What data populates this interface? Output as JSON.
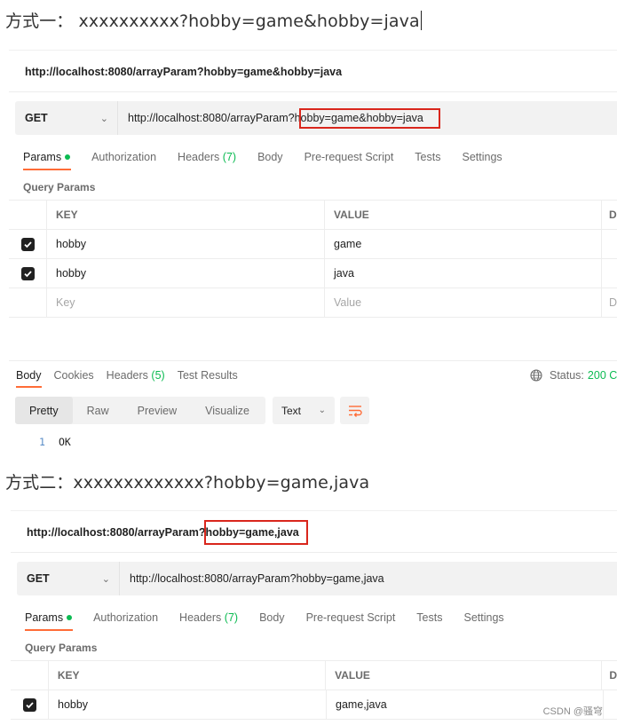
{
  "heading1": "方式一： xxxxxxxxxx?hobby=game&hobby=java",
  "heading2": "方式二：xxxxxxxxxxxxx?hobby=game,java",
  "panel1": {
    "request_name": "http://localhost:8080/arrayParam?hobby=game&hobby=java",
    "method": "GET",
    "url_base": "http://localhost:8080/arrayParam?",
    "url_query": "hobby=game&hobby=java",
    "tabs": [
      {
        "label": "Params",
        "active": true
      },
      {
        "label": "Authorization"
      },
      {
        "label": "Headers",
        "count": "(7)"
      },
      {
        "label": "Body"
      },
      {
        "label": "Pre-request Script"
      },
      {
        "label": "Tests"
      },
      {
        "label": "Settings"
      }
    ],
    "query_params_label": "Query Params",
    "columns": [
      "KEY",
      "VALUE",
      "D"
    ],
    "rows": [
      {
        "key": "hobby",
        "value": "game",
        "checked": true
      },
      {
        "key": "hobby",
        "value": "java",
        "checked": true
      }
    ],
    "placeholder": {
      "key": "Key",
      "value": "Value",
      "desc": "D"
    },
    "response_tabs": [
      {
        "label": "Body",
        "active": true
      },
      {
        "label": "Cookies"
      },
      {
        "label": "Headers",
        "count": "(5)"
      },
      {
        "label": "Test Results"
      }
    ],
    "status_label": "Status:",
    "status_value": "200 C",
    "view_modes": [
      "Pretty",
      "Raw",
      "Preview",
      "Visualize"
    ],
    "format": "Text",
    "line_number": "1",
    "line_text": "OK"
  },
  "panel2": {
    "request_name_base": "http://localhost:8080/arrayParam?",
    "request_name_query": "hobby=game,java",
    "method": "GET",
    "url": "http://localhost:8080/arrayParam?hobby=game,java",
    "tabs": [
      {
        "label": "Params",
        "active": true
      },
      {
        "label": "Authorization"
      },
      {
        "label": "Headers",
        "count": "(7)"
      },
      {
        "label": "Body"
      },
      {
        "label": "Pre-request Script"
      },
      {
        "label": "Tests"
      },
      {
        "label": "Settings"
      }
    ],
    "query_params_label": "Query Params",
    "columns": [
      "KEY",
      "VALUE",
      "D"
    ],
    "rows": [
      {
        "key": "hobby",
        "value": "game,java",
        "checked": true
      }
    ]
  },
  "watermark": "CSDN @骚穹",
  "colors": {
    "accent": "#ff6c37",
    "green": "#0cbb52",
    "highlight": "#d9261c"
  }
}
